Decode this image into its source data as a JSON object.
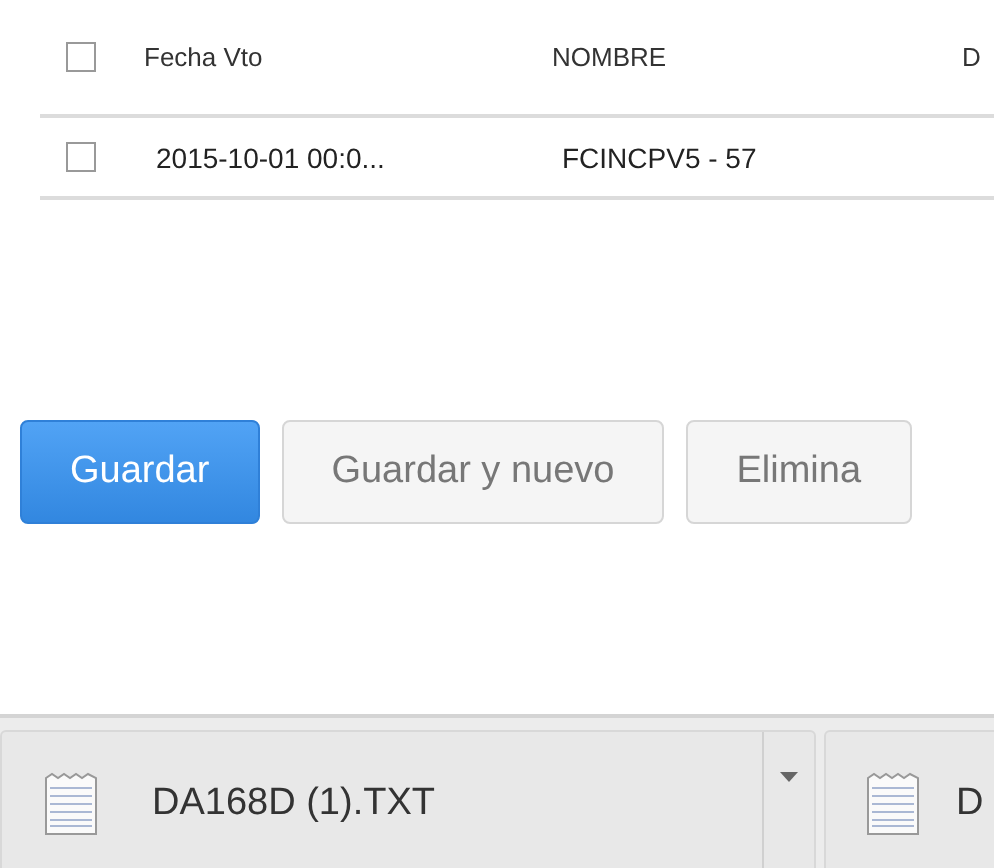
{
  "table": {
    "columns": [
      {
        "label": "Fecha Vto"
      },
      {
        "label": "NOMBRE"
      },
      {
        "label": "D"
      }
    ],
    "header_checked": false,
    "rows": [
      {
        "checked": false,
        "cells": [
          "2015-10-01 00:0...",
          "FCINCPV5 - 57"
        ]
      }
    ]
  },
  "buttons": [
    {
      "label": "Guardar",
      "kind": "primary"
    },
    {
      "label": "Guardar y nuevo",
      "kind": "default"
    },
    {
      "label": "Elimina",
      "kind": "default"
    }
  ],
  "downloads": [
    {
      "name": "DA168D (1).TXT"
    },
    {
      "name": "D"
    }
  ]
}
